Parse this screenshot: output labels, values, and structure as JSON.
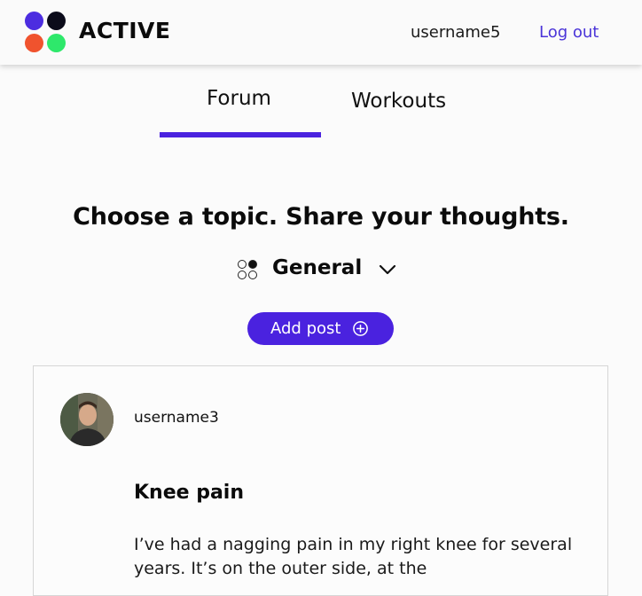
{
  "header": {
    "brand": "ACTIVE",
    "username": "username5",
    "logout_label": "Log out",
    "logo_colors": [
      "#4c2de0",
      "#0b0b1a",
      "#f0532e",
      "#2ee86b"
    ]
  },
  "tabs": [
    {
      "label": "Forum",
      "active": true
    },
    {
      "label": "Workouts",
      "active": false
    }
  ],
  "main": {
    "heading": "Choose a topic. Share your thoughts.",
    "topic": {
      "icon": "topic-dots-icon",
      "selected": "General"
    },
    "add_post_label": "Add post",
    "add_post_icon": "plus-circle-icon"
  },
  "post": {
    "username": "username3",
    "title": "Knee pain",
    "body": "I’ve had a nagging pain in my right knee for several years. It’s on the outer side, at the"
  },
  "colors": {
    "accent": "#4a22df",
    "link": "#4a34d8"
  }
}
